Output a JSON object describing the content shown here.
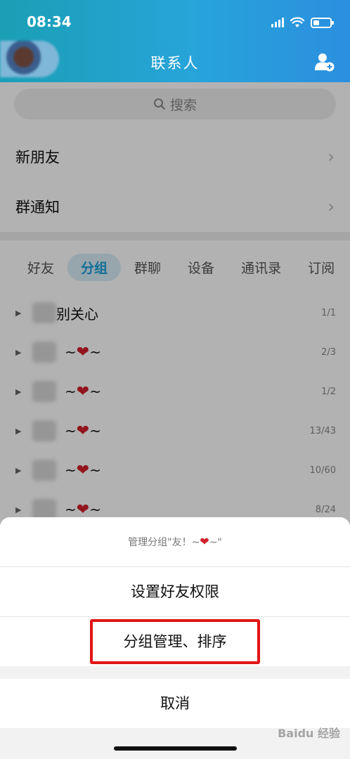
{
  "status_bar": {
    "time": "08:34"
  },
  "header": {
    "title": "联系人",
    "icons": [
      "avatar",
      "add-contact-icon"
    ]
  },
  "search": {
    "placeholder": "搜索"
  },
  "entries": [
    {
      "label": "新朋友"
    },
    {
      "label": "群通知"
    }
  ],
  "tabs": [
    {
      "label": "好友",
      "active": false
    },
    {
      "label": "分组",
      "active": true
    },
    {
      "label": "群聊",
      "active": false
    },
    {
      "label": "设备",
      "active": false
    },
    {
      "label": "通讯录",
      "active": false
    },
    {
      "label": "订阅"
    }
  ],
  "groups": [
    {
      "name": "别关心",
      "count": "1/1"
    },
    {
      "name": "~",
      "suffix": "~",
      "count": "2/3"
    },
    {
      "name": "~",
      "suffix": "~",
      "count": "1/2"
    },
    {
      "name": "~",
      "suffix": "~",
      "count": "13/43"
    },
    {
      "name": "~",
      "suffix": "~",
      "count": "10/60"
    },
    {
      "name": "~",
      "suffix": "~",
      "count": "8/24"
    }
  ],
  "action_sheet": {
    "title_prefix": "管理分组\"友！~",
    "title_suffix": "~\"",
    "items": [
      {
        "label": "设置好友权限"
      },
      {
        "label": "分组管理、排序",
        "highlighted": true
      }
    ],
    "cancel": "取消"
  },
  "watermark": "Baidu 经验",
  "colors": {
    "header": "#27a4d9",
    "accent": "#1a9fd9",
    "highlight": "#e01515",
    "heart": "#d21f2b"
  }
}
